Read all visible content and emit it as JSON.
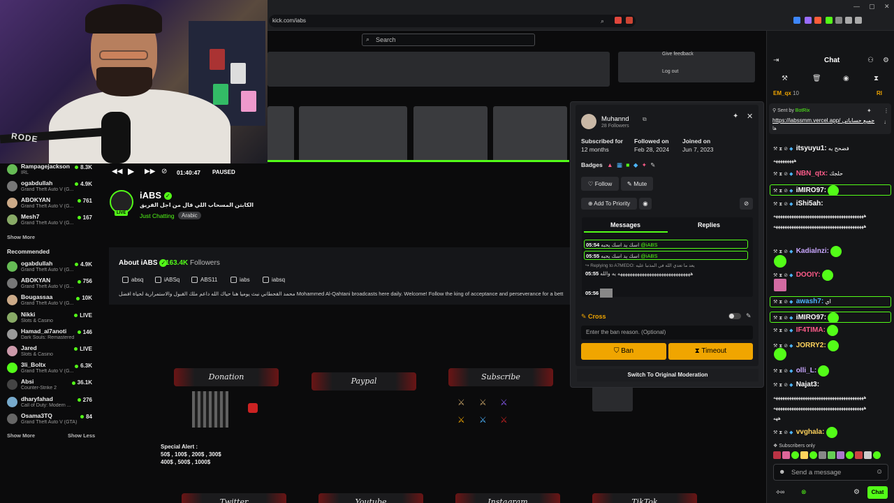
{
  "browser": {
    "url": "kick.com/iabs",
    "search_placeholder": "Search",
    "menu_feedback": "Give feedback",
    "menu_logout": "Log out"
  },
  "player": {
    "time": "01:40:47",
    "status": "PAUSED",
    "progress_fraction": 0.58
  },
  "webcam": {
    "mic_brand": "RODE"
  },
  "sidebar": {
    "top_items": [
      {
        "name": "Rampagejackson",
        "category": "IRL",
        "count": "8.3K"
      },
      {
        "name": "ogabdullah",
        "category": "Grand Theft Auto V (G...",
        "count": "4.9K"
      },
      {
        "name": "ABOKYAN",
        "category": "Grand Theft Auto V (G...",
        "count": "761"
      },
      {
        "name": "Mesh7",
        "category": "Grand Theft Auto V (G...",
        "count": "167"
      }
    ],
    "show_more": "Show More",
    "recommended_label": "Recommended",
    "recommended": [
      {
        "name": "ogabdullah",
        "category": "Grand Theft Auto V (G...",
        "count": "4.9K"
      },
      {
        "name": "ABOKYAN",
        "category": "Grand Theft Auto V (G...",
        "count": "756"
      },
      {
        "name": "Bougassaa",
        "category": "Grand Theft Auto V (G...",
        "count": "10K"
      },
      {
        "name": "Nikki",
        "category": "Slots & Casino",
        "count": "LIVE"
      },
      {
        "name": "Hamad_al7anoti",
        "category": "Dark Souls: Remastered",
        "count": "146"
      },
      {
        "name": "Jared",
        "category": "Slots & Casino",
        "count": "LIVE"
      },
      {
        "name": "3li_Boltx",
        "category": "Grand Theft Auto V (G...",
        "count": "6.3K"
      },
      {
        "name": "Absi",
        "category": "Counter-Strike 2",
        "count": "36.1K"
      },
      {
        "name": "dharyfahad",
        "category": "Call of Duty: Modern ...",
        "count": "276"
      },
      {
        "name": "Osama3TQ",
        "category": "Grand Theft Auto V (GTA)",
        "count": "84"
      }
    ],
    "show_more_2": "Show More",
    "show_less": "Show Less"
  },
  "channel": {
    "name": "iABS",
    "live_badge": "LIVE",
    "title": "الكابتن المسحاب اللي قال من اجل الفريق",
    "category": "Just Chatting",
    "language": "Arabic"
  },
  "about": {
    "heading": "About iABS",
    "followers": "163.4K",
    "followers_label": "Followers",
    "socials": [
      {
        "icon": "instagram-icon",
        "label": "absq"
      },
      {
        "icon": "x-icon",
        "label": "iABSq"
      },
      {
        "icon": "youtube-icon",
        "label": "ABS11"
      },
      {
        "icon": "discord-icon",
        "label": "iabs"
      },
      {
        "icon": "tiktok-icon",
        "label": "iabsq"
      }
    ],
    "bio": "محمد القحطاني نبث يوميا هنا حياك الله داعم ملك القبول والاستمرارية لحياة افضل Mohammed Al-Qahtani broadcasts here daily. Welcome! Follow the king of acceptance and perseverance for a bett"
  },
  "panels": {
    "donation": "Donation",
    "paypal": "Paypal",
    "subscribe": "Subscribe",
    "twitter": "Twitter",
    "youtube": "Youtube",
    "instagram": "Instagram",
    "tiktok": "TikTok",
    "alert_title": "Special Alert :",
    "alert_line1": "50$ , 100$ , 200$ , 300$",
    "alert_line2": "400$ , 500$ , 1000$"
  },
  "user_card": {
    "username": "Muhannd",
    "followers": "28 Followers",
    "subscribed_label": "Subscribed for",
    "subscribed_value": "12 months",
    "followed_label": "Followed on",
    "followed_value": "Feb 28, 2024",
    "joined_label": "Joined on",
    "joined_value": "Jun 7, 2023",
    "badges_label": "Badges",
    "follow_btn": "Follow",
    "mute_btn": "Mute",
    "priority_btn": "Add To Priority",
    "tab_messages": "Messages",
    "tab_replies": "Replies",
    "messages": [
      {
        "time": "05:54",
        "text": "اسك يد اسك يحبه",
        "mention": "@iABS",
        "highlight": true
      },
      {
        "time": "05:55",
        "text": "اسك يد اسك يحبه",
        "mention": "@iABS",
        "highlight": true
      },
      {
        "time": "",
        "text": "↪ Replying to A7MEDO: يعد ما تعدي الله في المذنبا عليه",
        "mention": "",
        "highlight": false
      },
      {
        "time": "05:55",
        "text": "ههههههههههههههههههههههههههههههه يه والله",
        "mention": "",
        "highlight": false
      },
      {
        "time": "05:56",
        "text": "",
        "mention": "",
        "highlight": false
      }
    ],
    "cross_label": "Cross",
    "ban_reason_placeholder": "Enter the ban reason. (Optional)",
    "ban_btn": "Ban",
    "timeout_btn": "Timeout",
    "switch_btn": "Switch To Original Moderation"
  },
  "chat": {
    "title": "Chat",
    "top_user": "EM_qx",
    "top_count": "10",
    "top_right": "RI",
    "pinned_sender": "Sent by",
    "pinned_bot": "BotRix",
    "pinned_link": "https://iabssmm.vercel.app/",
    "pinned_after": "جميع حساباتي",
    "pinned_text": "ها",
    "messages": [
      {
        "user": "itsyuyu1:",
        "color": "#ffffff",
        "text": "فضحح يه",
        "hl": false
      },
      {
        "user": "NBN_qtx:",
        "color": "#ff5c8a",
        "text": "حلجك",
        "hl": false
      },
      {
        "user": "iMIRO97:",
        "color": "#ffffff",
        "text": "",
        "hl": true
      },
      {
        "user": "iShi5ah:",
        "color": "#ffffff",
        "text": "",
        "hl": false
      },
      {
        "user": "Kadialnzi:",
        "color": "#c9a7ff",
        "text": "",
        "hl": false
      },
      {
        "user": "DOOIY:",
        "color": "#ff5c8a",
        "text": "",
        "hl": false
      },
      {
        "user": "awash7:",
        "color": "#4db5ff",
        "text": "اي",
        "hl": true
      },
      {
        "user": "iMIRO97:",
        "color": "#ffffff",
        "text": "",
        "hl": true
      },
      {
        "user": "IF4TIMA:",
        "color": "#ff5c8a",
        "text": "",
        "hl": false
      },
      {
        "user": "JORRY2:",
        "color": "#ffd35c",
        "text": "",
        "hl": false
      },
      {
        "user": "olli_L:",
        "color": "#c9a7ff",
        "text": "",
        "hl": false
      },
      {
        "user": "Najat3:",
        "color": "#ffffff",
        "text": "",
        "hl": false
      },
      {
        "user": "vvghala:",
        "color": "#ffd35c",
        "text": "",
        "hl": false
      }
    ],
    "laugh_line": "ههههههههههههههههههههههههههههههههههههههههه",
    "laugh_line_2": "هههههههههه",
    "laugh_line_3": "ههههههههههههههههههههههههههههههههههههههههه",
    "laugh_line_4": "ههه",
    "subscribers_only": "Subscribers only",
    "input_placeholder": "Send a message",
    "send_btn": "Chat"
  },
  "colors": {
    "accent": "#53fc18",
    "ban": "#f0a500",
    "bg": "#0b0b0c"
  }
}
